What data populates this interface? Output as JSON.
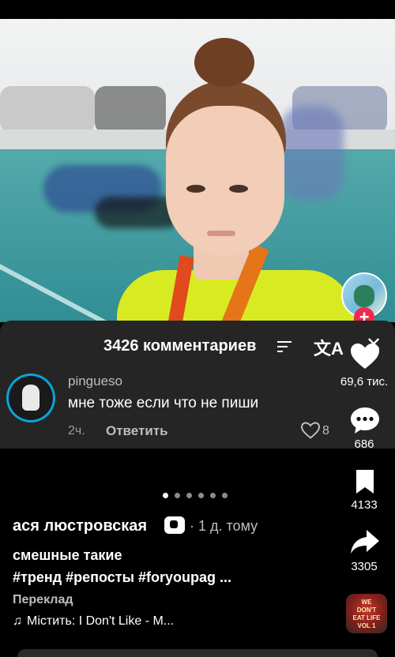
{
  "comments": {
    "title": "3426 комментариев",
    "items": [
      {
        "username": "pingueso",
        "text": "мне тоже если что не пиши",
        "time": "2ч.",
        "reply_label": "Ответить",
        "likes": "8"
      }
    ]
  },
  "rail": {
    "likes": "69,6 тис.",
    "comments": "686",
    "saves": "4133",
    "shares": "3305"
  },
  "post": {
    "author": "ася люстровская",
    "posted_ago": "· 1 д. тому",
    "caption": "смешные такие",
    "hashtags": "#тренд #репосты #foryoupag ...",
    "translate_label": "Переклад",
    "music": "Містить: I Don't Like - M...",
    "carousel": {
      "count": 6,
      "active": 1
    },
    "disc_text": [
      "WE",
      "DON'T",
      "EAT LIFE",
      "VOL 1"
    ]
  },
  "colors": {
    "follow_accent": "#f0294d",
    "sheet_bg": "#252525",
    "avatar_ring": "#05a6d8"
  },
  "icons": [
    "heart-icon",
    "comment-icon",
    "bookmark-icon",
    "share-icon",
    "music-note-icon",
    "translate-icon",
    "close-icon",
    "sort-icon"
  ]
}
